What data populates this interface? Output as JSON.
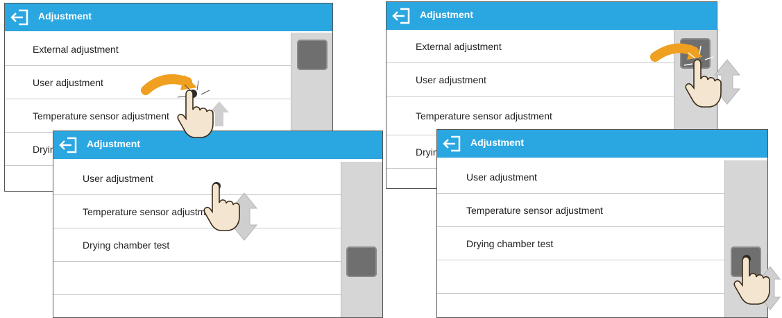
{
  "window_title": "Adjustment",
  "panel_a_back": {
    "items": [
      "External adjustment",
      "User adjustment",
      "Temperature sensor adjustment",
      "Drying chamber test"
    ]
  },
  "panel_a_front": {
    "items": [
      "User adjustment",
      "Temperature sensor adjustment",
      "Drying chamber test",
      "",
      ""
    ]
  },
  "panel_b_back": {
    "items": [
      "External adjustment",
      "User adjustment",
      "Temperature sensor adjustment",
      "Drying chamber test"
    ]
  },
  "panel_b_front": {
    "items": [
      "User adjustment",
      "Temperature sensor adjustment",
      "Drying chamber test",
      "",
      ""
    ]
  },
  "icons": {
    "back": "back-arrow-icon",
    "tap_hand": "tap-hand-icon",
    "swipe_arrow": "curved-swipe-arrow-icon",
    "scroll_arrow": "up-down-arrow-icon"
  },
  "colors": {
    "titlebar": "#2aa6e0",
    "scrollbar": "#d6d6d6",
    "thumb": "#6f6f6f",
    "gesture_arrow": "#f0a020"
  }
}
